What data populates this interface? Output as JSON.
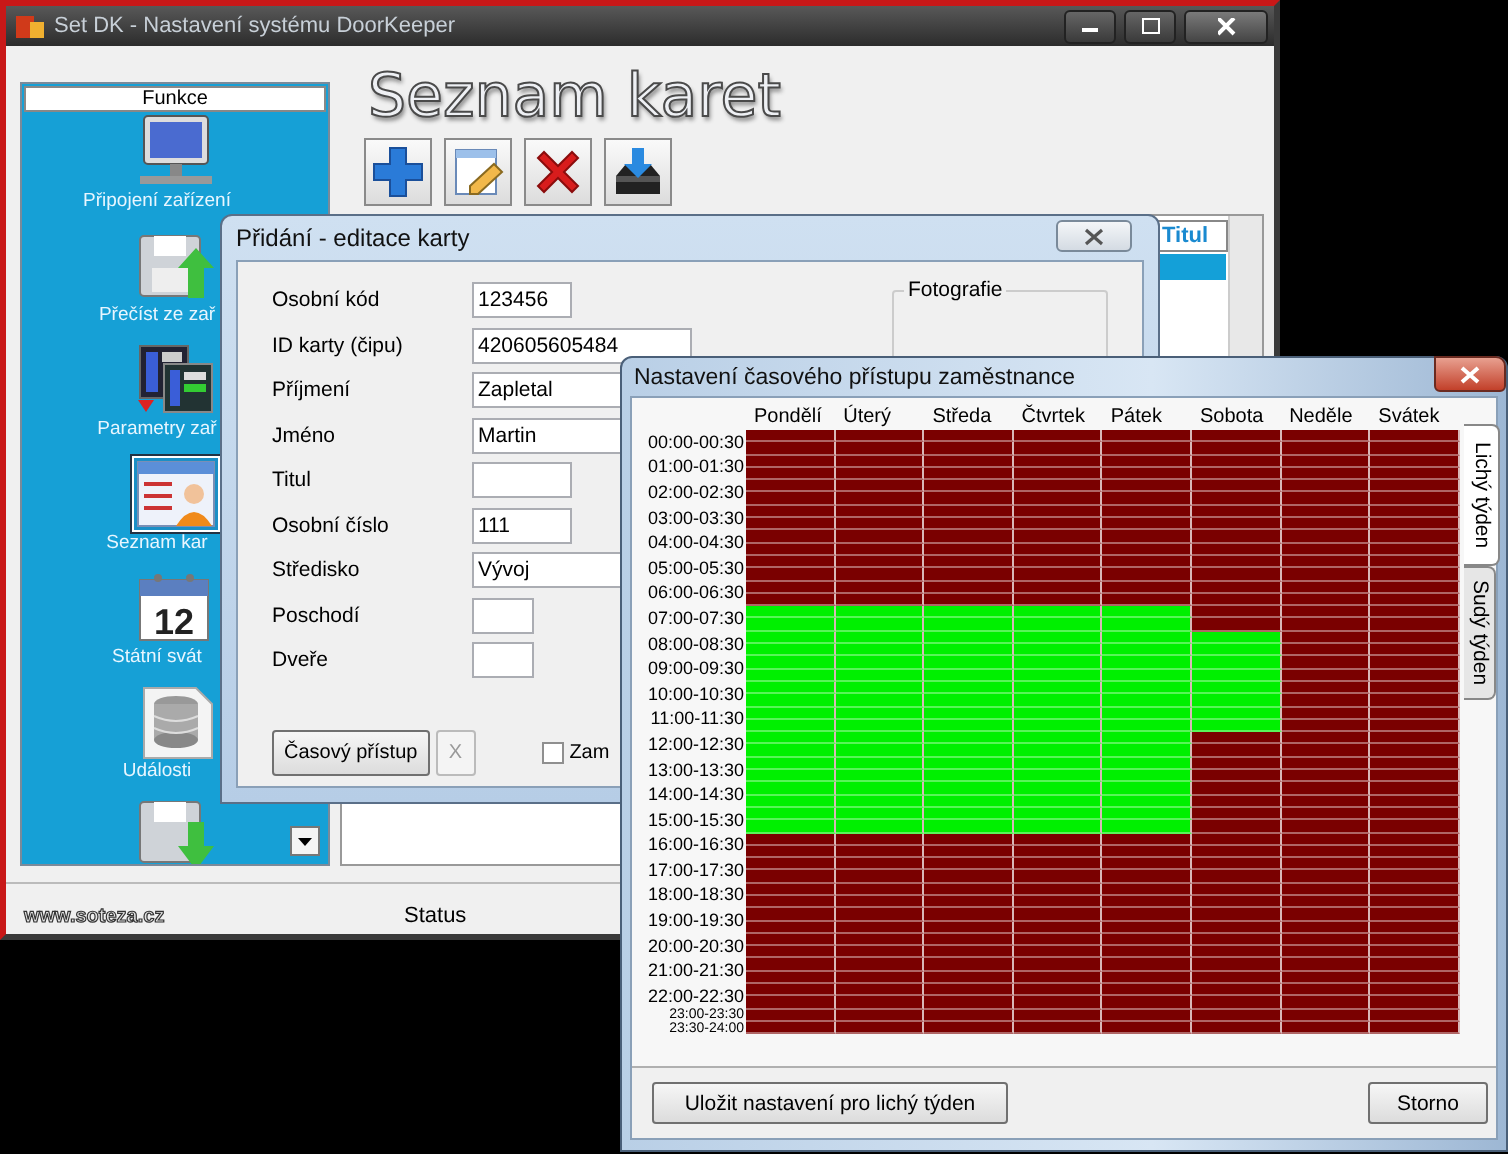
{
  "main_window": {
    "title": "Set DK - Nastavení systému DoorKeeper",
    "sidebar": {
      "header": "Funkce",
      "items": [
        {
          "kind": "monitor",
          "label": "Připojení zařízení",
          "selected": false
        },
        {
          "kind": "upload",
          "label": "Přečíst ze zař",
          "selected": false
        },
        {
          "kind": "params",
          "label": "Parametry zař",
          "selected": false
        },
        {
          "kind": "cards",
          "label": "Seznam kar",
          "selected": true
        },
        {
          "kind": "calendar",
          "label": "Státní svát",
          "day": "12",
          "selected": false
        },
        {
          "kind": "database",
          "label": "Události",
          "selected": false
        },
        {
          "kind": "download",
          "selected": false
        }
      ]
    },
    "heading": "Seznam karet",
    "toolbar": [
      {
        "kind": "add"
      },
      {
        "kind": "edit"
      },
      {
        "kind": "delete"
      },
      {
        "kind": "export"
      }
    ],
    "table": {
      "columns": [
        "Titul"
      ]
    },
    "website": "www.soteza.cz",
    "status": "Status"
  },
  "card_dialog": {
    "title": "Přidání - editace karty",
    "fields": [
      {
        "label": "Osobní kód",
        "value": "123456",
        "kind": "short"
      },
      {
        "label": "ID karty (čipu)",
        "value": "420605605484",
        "kind": "long"
      },
      {
        "label": "Příjmení",
        "value": "Zapletal",
        "kind": "long"
      },
      {
        "label": "Jméno",
        "value": "Martin",
        "kind": "long"
      },
      {
        "label": "Titul",
        "kind": "short"
      },
      {
        "label": "Osobní číslo",
        "value": "111",
        "kind": "short"
      },
      {
        "label": "Středisko",
        "value": "Vývoj",
        "kind": "long"
      },
      {
        "label": "Poschodí",
        "kind": "tiny"
      },
      {
        "label": "Dveře",
        "kind": "tiny"
      }
    ],
    "photo_group": "Fotografie",
    "buttons": [
      {
        "label": "Časový přístup",
        "disabled": false
      },
      {
        "label": "X",
        "disabled": true
      }
    ],
    "checkbox": {
      "label": "Zam",
      "checked": false
    }
  },
  "access_window": {
    "title": "Nastavení časového přístupu zaměstnance",
    "days": [
      "Pondělí",
      "Úterý",
      "Středa",
      "Čtvrtek",
      "Pátek",
      "Sobota",
      "Neděle",
      "Svátek"
    ],
    "rows": [
      {
        "label": "00:00-00:30",
        "allowed": [
          false,
          false,
          false,
          false,
          false,
          false,
          false,
          false
        ]
      },
      {
        "allowed": [
          false,
          false,
          false,
          false,
          false,
          false,
          false,
          false
        ]
      },
      {
        "label": "01:00-01:30",
        "allowed": [
          false,
          false,
          false,
          false,
          false,
          false,
          false,
          false
        ]
      },
      {
        "allowed": [
          false,
          false,
          false,
          false,
          false,
          false,
          false,
          false
        ]
      },
      {
        "label": "02:00-02:30",
        "allowed": [
          false,
          false,
          false,
          false,
          false,
          false,
          false,
          false
        ]
      },
      {
        "allowed": [
          false,
          false,
          false,
          false,
          false,
          false,
          false,
          false
        ]
      },
      {
        "label": "03:00-03:30",
        "allowed": [
          false,
          false,
          false,
          false,
          false,
          false,
          false,
          false
        ]
      },
      {
        "allowed": [
          false,
          false,
          false,
          false,
          false,
          false,
          false,
          false
        ]
      },
      {
        "label": "04:00-04:30",
        "allowed": [
          false,
          false,
          false,
          false,
          false,
          false,
          false,
          false
        ]
      },
      {
        "allowed": [
          false,
          false,
          false,
          false,
          false,
          false,
          false,
          false
        ]
      },
      {
        "label": "05:00-05:30",
        "allowed": [
          false,
          false,
          false,
          false,
          false,
          false,
          false,
          false
        ]
      },
      {
        "allowed": [
          false,
          false,
          false,
          false,
          false,
          false,
          false,
          false
        ]
      },
      {
        "label": "06:00-06:30",
        "allowed": [
          false,
          false,
          false,
          false,
          false,
          false,
          false,
          false
        ]
      },
      {
        "allowed": [
          false,
          false,
          false,
          false,
          false,
          false,
          false,
          false
        ]
      },
      {
        "label": "07:00-07:30",
        "allowed": [
          true,
          true,
          true,
          true,
          true,
          false,
          false,
          false
        ]
      },
      {
        "allowed": [
          true,
          true,
          true,
          true,
          true,
          false,
          false,
          false
        ]
      },
      {
        "label": "08:00-08:30",
        "allowed": [
          true,
          true,
          true,
          true,
          true,
          true,
          false,
          false
        ]
      },
      {
        "allowed": [
          true,
          true,
          true,
          true,
          true,
          true,
          false,
          false
        ]
      },
      {
        "label": "09:00-09:30",
        "allowed": [
          true,
          true,
          true,
          true,
          true,
          true,
          false,
          false
        ]
      },
      {
        "allowed": [
          true,
          true,
          true,
          true,
          true,
          true,
          false,
          false
        ]
      },
      {
        "label": "10:00-10:30",
        "allowed": [
          true,
          true,
          true,
          true,
          true,
          true,
          false,
          false
        ]
      },
      {
        "allowed": [
          true,
          true,
          true,
          true,
          true,
          true,
          false,
          false
        ]
      },
      {
        "label": "11:00-11:30",
        "allowed": [
          true,
          true,
          true,
          true,
          true,
          true,
          false,
          false
        ]
      },
      {
        "allowed": [
          true,
          true,
          true,
          true,
          true,
          true,
          false,
          false
        ]
      },
      {
        "label": "12:00-12:30",
        "allowed": [
          true,
          true,
          true,
          true,
          true,
          false,
          false,
          false
        ]
      },
      {
        "allowed": [
          true,
          true,
          true,
          true,
          true,
          false,
          false,
          false
        ]
      },
      {
        "label": "13:00-13:30",
        "allowed": [
          true,
          true,
          true,
          true,
          true,
          false,
          false,
          false
        ]
      },
      {
        "allowed": [
          true,
          true,
          true,
          true,
          true,
          false,
          false,
          false
        ]
      },
      {
        "label": "14:00-14:30",
        "allowed": [
          true,
          true,
          true,
          true,
          true,
          false,
          false,
          false
        ]
      },
      {
        "allowed": [
          true,
          true,
          true,
          true,
          true,
          false,
          false,
          false
        ]
      },
      {
        "label": "15:00-15:30",
        "allowed": [
          true,
          true,
          true,
          true,
          true,
          false,
          false,
          false
        ]
      },
      {
        "allowed": [
          true,
          true,
          true,
          true,
          true,
          false,
          false,
          false
        ]
      },
      {
        "label": "16:00-16:30",
        "allowed": [
          false,
          false,
          false,
          false,
          false,
          false,
          false,
          false
        ]
      },
      {
        "allowed": [
          false,
          false,
          false,
          false,
          false,
          false,
          false,
          false
        ]
      },
      {
        "label": "17:00-17:30",
        "allowed": [
          false,
          false,
          false,
          false,
          false,
          false,
          false,
          false
        ]
      },
      {
        "allowed": [
          false,
          false,
          false,
          false,
          false,
          false,
          false,
          false
        ]
      },
      {
        "label": "18:00-18:30",
        "allowed": [
          false,
          false,
          false,
          false,
          false,
          false,
          false,
          false
        ]
      },
      {
        "allowed": [
          false,
          false,
          false,
          false,
          false,
          false,
          false,
          false
        ]
      },
      {
        "label": "19:00-19:30",
        "allowed": [
          false,
          false,
          false,
          false,
          false,
          false,
          false,
          false
        ]
      },
      {
        "allowed": [
          false,
          false,
          false,
          false,
          false,
          false,
          false,
          false
        ]
      },
      {
        "label": "20:00-20:30",
        "allowed": [
          false,
          false,
          false,
          false,
          false,
          false,
          false,
          false
        ]
      },
      {
        "allowed": [
          false,
          false,
          false,
          false,
          false,
          false,
          false,
          false
        ]
      },
      {
        "label": "21:00-21:30",
        "allowed": [
          false,
          false,
          false,
          false,
          false,
          false,
          false,
          false
        ]
      },
      {
        "allowed": [
          false,
          false,
          false,
          false,
          false,
          false,
          false,
          false
        ]
      },
      {
        "label": "22:00-22:30",
        "allowed": [
          false,
          false,
          false,
          false,
          false,
          false,
          false,
          false
        ]
      },
      {
        "allowed": [
          false,
          false,
          false,
          false,
          false,
          false,
          false,
          false
        ]
      },
      {
        "label": "23:00-23:30",
        "allowed": [
          false,
          false,
          false,
          false,
          false,
          false,
          false,
          false
        ]
      },
      {
        "label": "23:30-24:00",
        "allowed": [
          false,
          false,
          false,
          false,
          false,
          false,
          false,
          false
        ]
      }
    ],
    "tabs": [
      {
        "label": "Lichý týden",
        "selected": true
      },
      {
        "label": "Sudý týden",
        "selected": false
      }
    ],
    "buttons": [
      "Uložit nastavení pro lichý týden",
      "Storno"
    ]
  }
}
